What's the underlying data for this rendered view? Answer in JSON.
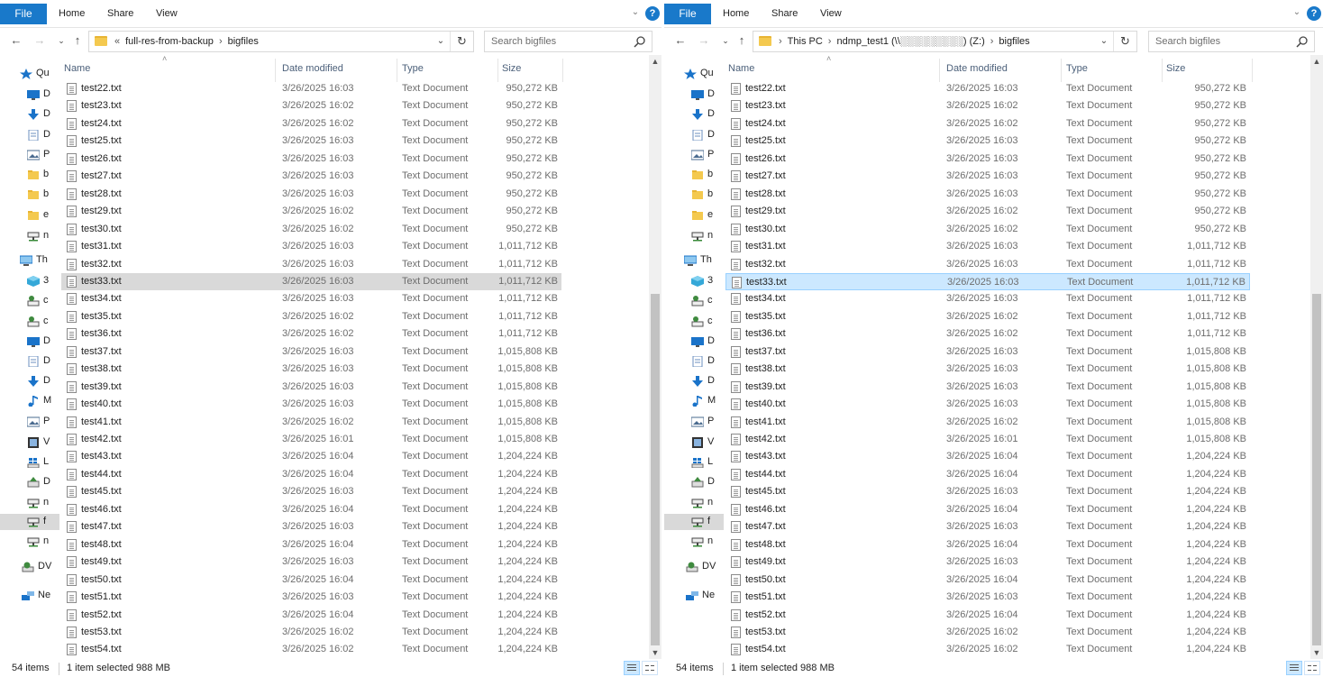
{
  "ribbon": {
    "file": "File",
    "home": "Home",
    "share": "Share",
    "view": "View",
    "help": "?"
  },
  "left": {
    "breadcrumbs": [
      "«",
      "full-res-from-backup",
      "›",
      "bigfiles"
    ],
    "search_placeholder": "Search bigfiles",
    "status_items": "54 items",
    "status_selected": "1 item selected  988 MB",
    "nav_pane": [
      {
        "icon": "star-icon",
        "label": "Qu",
        "color": "#1a73c9"
      },
      {
        "icon": "desktop-icon",
        "label": "D",
        "color": "#1a73c9"
      },
      {
        "icon": "download-icon",
        "label": "D",
        "color": "#1a73c9"
      },
      {
        "icon": "document-icon",
        "label": "D",
        "color": "#6b8fbf"
      },
      {
        "icon": "picture-icon",
        "label": "P",
        "color": "#4a6b8f"
      },
      {
        "icon": "folder-icon",
        "label": "b",
        "color": "#f4c94f"
      },
      {
        "icon": "folder-icon",
        "label": "b",
        "color": "#f4c94f"
      },
      {
        "icon": "folder-icon",
        "label": "e",
        "color": "#f4c94f"
      },
      {
        "icon": "network-drive-icon",
        "label": "n",
        "color": "#444444"
      },
      {
        "icon": "this-pc-icon",
        "label": "Th",
        "color": "#1a73c9"
      },
      {
        "icon": "3d-objects-icon",
        "label": "3",
        "color": "#35a8d8"
      },
      {
        "icon": "network-location-icon",
        "label": "c",
        "color": "#3f8a3f"
      },
      {
        "icon": "network-location-icon",
        "label": "c",
        "color": "#3f8a3f"
      },
      {
        "icon": "desktop-icon",
        "label": "D",
        "color": "#1a73c9"
      },
      {
        "icon": "document-icon",
        "label": "D",
        "color": "#6b8fbf"
      },
      {
        "icon": "download-icon",
        "label": "D",
        "color": "#1a73c9"
      },
      {
        "icon": "music-icon",
        "label": "M",
        "color": "#1a73c9"
      },
      {
        "icon": "picture-icon",
        "label": "P",
        "color": "#4a6b8f"
      },
      {
        "icon": "video-icon",
        "label": "V",
        "color": "#4a6b8f"
      },
      {
        "icon": "windows-drive-icon",
        "label": "L",
        "color": "#1a73c9"
      },
      {
        "icon": "drive-icon",
        "label": "D",
        "color": "#3f8a3f"
      },
      {
        "icon": "network-drive-icon",
        "label": "n",
        "color": "#444444"
      },
      {
        "icon": "network-drive-icon",
        "label": "f",
        "color": "#444444"
      },
      {
        "icon": "network-drive-icon",
        "label": "n",
        "color": "#444444"
      },
      {
        "icon": "dvd-drive-icon",
        "label": "DV",
        "color": "#3f8a3f"
      },
      {
        "icon": "network-icon",
        "label": "Ne",
        "color": "#1a73c9"
      }
    ]
  },
  "right": {
    "breadcrumbs": [
      "›",
      "This PC",
      "›",
      "ndmp_test1 (\\\\░░░░░░░░░) (Z:)",
      "›",
      "bigfiles"
    ],
    "search_placeholder": "Search bigfiles",
    "status_items": "54 items",
    "status_selected": "1 item selected  988 MB"
  },
  "columns": {
    "name": "Name",
    "date": "Date modified",
    "type": "Type",
    "size": "Size"
  },
  "files": [
    {
      "name": "test22.txt",
      "date": "3/26/2025 16:03",
      "type": "Text Document",
      "size": "950,272 KB"
    },
    {
      "name": "test23.txt",
      "date": "3/26/2025 16:02",
      "type": "Text Document",
      "size": "950,272 KB"
    },
    {
      "name": "test24.txt",
      "date": "3/26/2025 16:02",
      "type": "Text Document",
      "size": "950,272 KB"
    },
    {
      "name": "test25.txt",
      "date": "3/26/2025 16:03",
      "type": "Text Document",
      "size": "950,272 KB"
    },
    {
      "name": "test26.txt",
      "date": "3/26/2025 16:03",
      "type": "Text Document",
      "size": "950,272 KB"
    },
    {
      "name": "test27.txt",
      "date": "3/26/2025 16:03",
      "type": "Text Document",
      "size": "950,272 KB"
    },
    {
      "name": "test28.txt",
      "date": "3/26/2025 16:03",
      "type": "Text Document",
      "size": "950,272 KB"
    },
    {
      "name": "test29.txt",
      "date": "3/26/2025 16:02",
      "type": "Text Document",
      "size": "950,272 KB"
    },
    {
      "name": "test30.txt",
      "date": "3/26/2025 16:02",
      "type": "Text Document",
      "size": "950,272 KB"
    },
    {
      "name": "test31.txt",
      "date": "3/26/2025 16:03",
      "type": "Text Document",
      "size": "1,011,712 KB"
    },
    {
      "name": "test32.txt",
      "date": "3/26/2025 16:03",
      "type": "Text Document",
      "size": "1,011,712 KB"
    },
    {
      "name": "test33.txt",
      "date": "3/26/2025 16:03",
      "type": "Text Document",
      "size": "1,011,712 KB",
      "selected": true
    },
    {
      "name": "test34.txt",
      "date": "3/26/2025 16:03",
      "type": "Text Document",
      "size": "1,011,712 KB"
    },
    {
      "name": "test35.txt",
      "date": "3/26/2025 16:02",
      "type": "Text Document",
      "size": "1,011,712 KB"
    },
    {
      "name": "test36.txt",
      "date": "3/26/2025 16:02",
      "type": "Text Document",
      "size": "1,011,712 KB"
    },
    {
      "name": "test37.txt",
      "date": "3/26/2025 16:03",
      "type": "Text Document",
      "size": "1,015,808 KB"
    },
    {
      "name": "test38.txt",
      "date": "3/26/2025 16:03",
      "type": "Text Document",
      "size": "1,015,808 KB"
    },
    {
      "name": "test39.txt",
      "date": "3/26/2025 16:03",
      "type": "Text Document",
      "size": "1,015,808 KB"
    },
    {
      "name": "test40.txt",
      "date": "3/26/2025 16:03",
      "type": "Text Document",
      "size": "1,015,808 KB"
    },
    {
      "name": "test41.txt",
      "date": "3/26/2025 16:02",
      "type": "Text Document",
      "size": "1,015,808 KB"
    },
    {
      "name": "test42.txt",
      "date": "3/26/2025 16:01",
      "type": "Text Document",
      "size": "1,015,808 KB"
    },
    {
      "name": "test43.txt",
      "date": "3/26/2025 16:04",
      "type": "Text Document",
      "size": "1,204,224 KB"
    },
    {
      "name": "test44.txt",
      "date": "3/26/2025 16:04",
      "type": "Text Document",
      "size": "1,204,224 KB"
    },
    {
      "name": "test45.txt",
      "date": "3/26/2025 16:03",
      "type": "Text Document",
      "size": "1,204,224 KB"
    },
    {
      "name": "test46.txt",
      "date": "3/26/2025 16:04",
      "type": "Text Document",
      "size": "1,204,224 KB"
    },
    {
      "name": "test47.txt",
      "date": "3/26/2025 16:03",
      "type": "Text Document",
      "size": "1,204,224 KB"
    },
    {
      "name": "test48.txt",
      "date": "3/26/2025 16:04",
      "type": "Text Document",
      "size": "1,204,224 KB"
    },
    {
      "name": "test49.txt",
      "date": "3/26/2025 16:03",
      "type": "Text Document",
      "size": "1,204,224 KB"
    },
    {
      "name": "test50.txt",
      "date": "3/26/2025 16:04",
      "type": "Text Document",
      "size": "1,204,224 KB"
    },
    {
      "name": "test51.txt",
      "date": "3/26/2025 16:03",
      "type": "Text Document",
      "size": "1,204,224 KB"
    },
    {
      "name": "test52.txt",
      "date": "3/26/2025 16:04",
      "type": "Text Document",
      "size": "1,204,224 KB"
    },
    {
      "name": "test53.txt",
      "date": "3/26/2025 16:02",
      "type": "Text Document",
      "size": "1,204,224 KB"
    },
    {
      "name": "test54.txt",
      "date": "3/26/2025 16:02",
      "type": "Text Document",
      "size": "1,204,224 KB"
    }
  ],
  "colors": {
    "accent": "#1979ca",
    "selection_blue": "#cce8ff",
    "selection_gray": "#d9d9d9"
  }
}
